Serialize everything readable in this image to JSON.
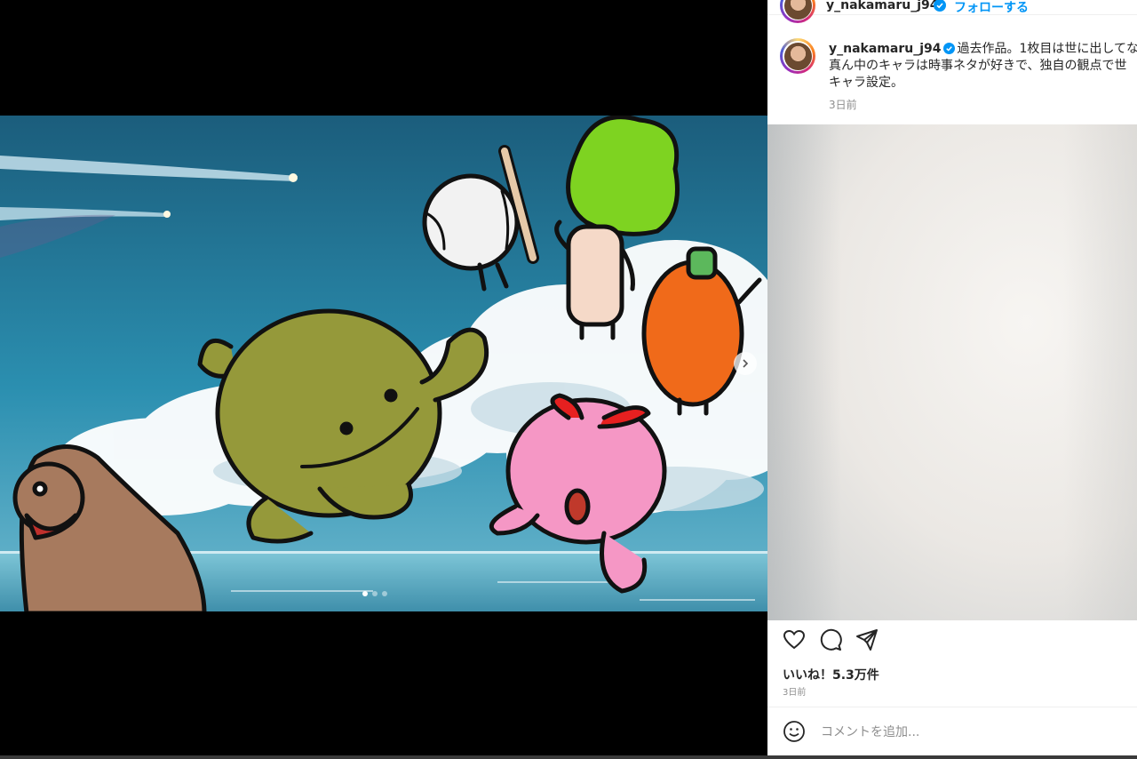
{
  "post": {
    "username": "y_nakamaru_j94",
    "follow_label": "フォローする",
    "caption_line1": "過去作品。1枚目は世に出してな",
    "caption_line2": "真ん中のキャラは時事ネタが好きで、独自の観点で世",
    "caption_line3": "キャラ設定。",
    "caption_time": "3日前",
    "likes": "いいね！5.3万件",
    "time": "3日前",
    "comment_placeholder": "コメントを追加..."
  },
  "carousel": {
    "current": 1,
    "total": 3
  },
  "colors": {
    "accent": "#0095f6",
    "verified": "#0095f6",
    "text": "#262626",
    "muted": "#8e8e8e"
  },
  "icons": [
    "verified-badge-icon",
    "chevron-right-icon",
    "heart-icon",
    "comment-icon",
    "share-icon",
    "emoji-icon"
  ]
}
